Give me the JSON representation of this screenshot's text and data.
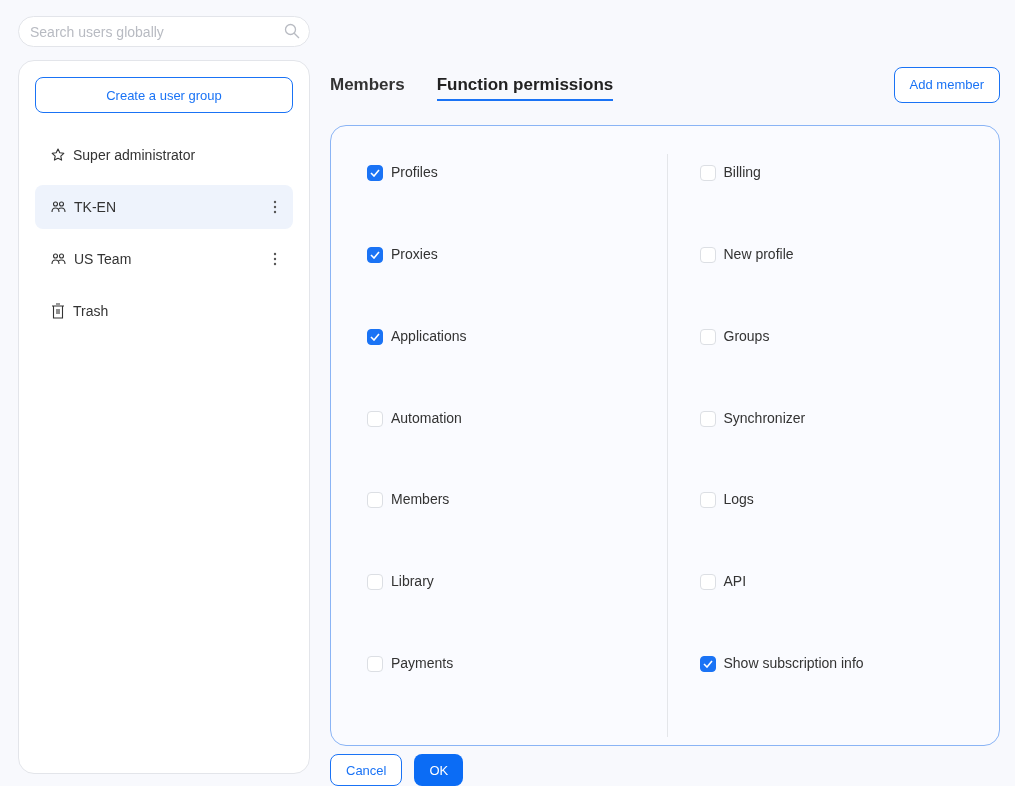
{
  "search": {
    "placeholder": "Search users globally"
  },
  "sidebar": {
    "create_button": "Create a user group",
    "items": [
      {
        "kind": "star",
        "label": "Super administrator",
        "selected": false
      },
      {
        "kind": "group",
        "label": "TK-EN",
        "selected": true
      },
      {
        "kind": "group",
        "label": "US Team",
        "selected": false
      },
      {
        "kind": "trash",
        "label": "Trash",
        "selected": false
      }
    ]
  },
  "tabs": [
    {
      "label": "Members",
      "selected": false
    },
    {
      "label": "Function permissions",
      "selected": true
    }
  ],
  "add_member_button": "Add member",
  "permissions": {
    "columns": [
      [
        {
          "label": "Profiles",
          "checked": true
        },
        {
          "label": "Proxies",
          "checked": true
        },
        {
          "label": "Applications",
          "checked": true
        },
        {
          "label": "Automation",
          "checked": false
        },
        {
          "label": "Members",
          "checked": false
        },
        {
          "label": "Library",
          "checked": false
        },
        {
          "label": "Payments",
          "checked": false
        }
      ],
      [
        {
          "label": "Billing",
          "checked": false
        },
        {
          "label": "New profile",
          "checked": false
        },
        {
          "label": "Groups",
          "checked": false
        },
        {
          "label": "Synchronizer",
          "checked": false
        },
        {
          "label": "Logs",
          "checked": false
        },
        {
          "label": "API",
          "checked": false
        },
        {
          "label": "Show subscription info",
          "checked": true
        }
      ]
    ]
  },
  "buttons": {
    "cancel": "Cancel",
    "ok": "OK"
  }
}
